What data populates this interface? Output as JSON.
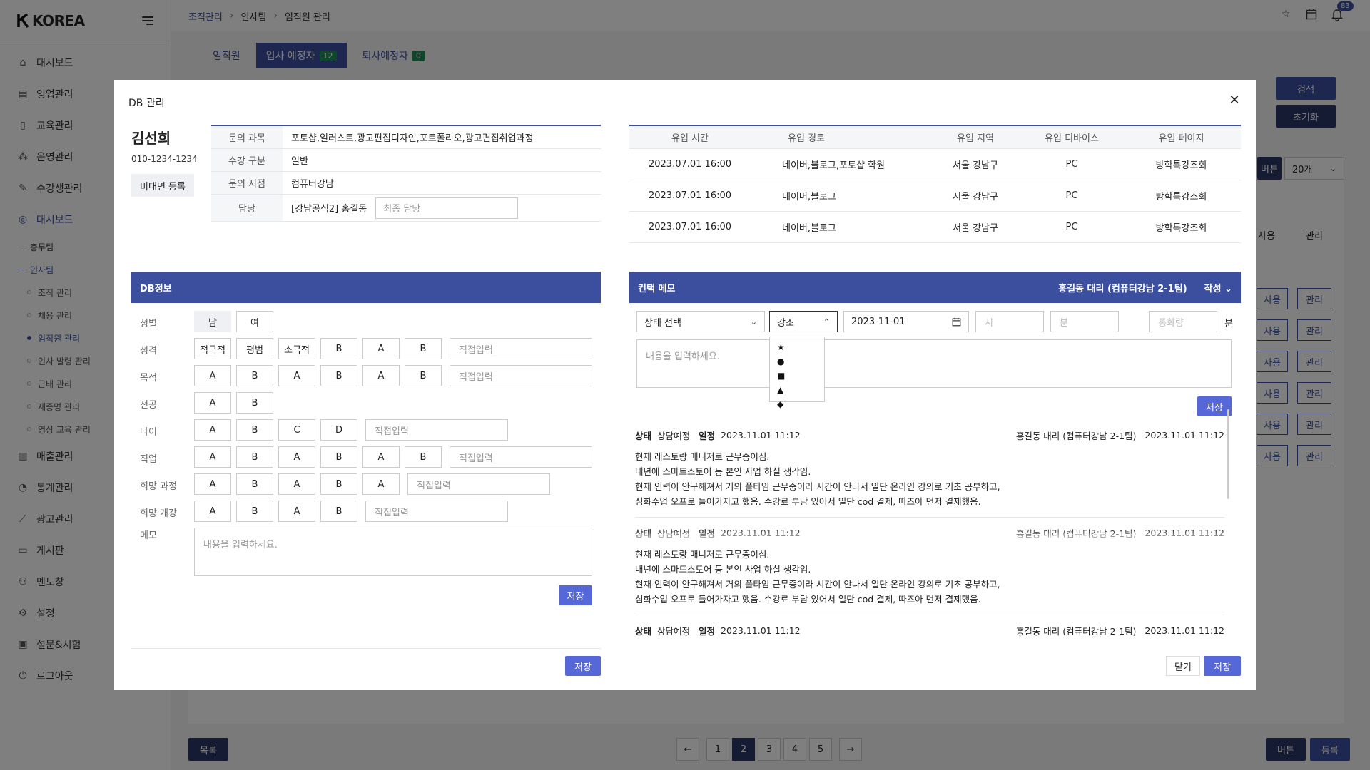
{
  "brand": "KOREA",
  "sidebar": {
    "items": [
      {
        "label": "대시보드",
        "icon": "home-icon"
      },
      {
        "label": "영업관리",
        "icon": "store-icon"
      },
      {
        "label": "교육관리",
        "icon": "book-icon"
      },
      {
        "label": "운영관리",
        "icon": "grid-icon"
      },
      {
        "label": "수강생관리",
        "icon": "edit-icon"
      },
      {
        "label": "대시보드",
        "icon": "globe-icon",
        "active": true
      }
    ],
    "sub1": [
      "총무팀",
      "인사팀"
    ],
    "sub2": [
      "조직 관리",
      "채용 관리",
      "임직원 관리",
      "인사 발령 관리",
      "근태 관리",
      "재증명 관리",
      "영상 교육 관리"
    ],
    "items_bottom": [
      {
        "label": "매출관리",
        "icon": "bar-chart-icon"
      },
      {
        "label": "통계관리",
        "icon": "pie-chart-icon"
      },
      {
        "label": "광고관리",
        "icon": "line-chart-icon"
      },
      {
        "label": "게시판",
        "icon": "document-icon"
      },
      {
        "label": "멘토창",
        "icon": "users-icon"
      },
      {
        "label": "설정",
        "icon": "gear-icon"
      },
      {
        "label": "설문&시험",
        "icon": "survey-icon"
      },
      {
        "label": "로그아웃",
        "icon": "power-icon"
      }
    ]
  },
  "breadcrumb": [
    "조직관리",
    "인사팀",
    "임직원 관리"
  ],
  "notifications_count": "83",
  "bg": {
    "tabs": [
      {
        "label": "임직원"
      },
      {
        "label": "입사 예정자",
        "count": "12"
      },
      {
        "label": "퇴사예정자",
        "count": "0"
      }
    ],
    "search_btn": "검색",
    "reset_btn": "초기화",
    "button_label": "버튼",
    "page_size": "20개",
    "col_use": "사용",
    "col_manage": "관리",
    "row_use": "사용",
    "row_manage": "관리",
    "list_btn": "목록",
    "register_btn": "등록",
    "pages": [
      "1",
      "2",
      "3",
      "4",
      "5"
    ],
    "current_page": "2"
  },
  "modal": {
    "title": "DB 관리",
    "person": {
      "name": "김선희",
      "phone": "010-1234-1234",
      "type_btn": "비대면 등록"
    },
    "info": [
      {
        "key": "문의 과목",
        "value": "포토샵,일러스트,광고편집디자인,포트폴리오,광고편집취업과정"
      },
      {
        "key": "수강 구분",
        "value": "일반"
      },
      {
        "key": "문의 지점",
        "value": "컴퓨터강남"
      },
      {
        "key": "담당",
        "value": "[강남공식2] 홍길동",
        "placeholder": "최종 담당"
      }
    ],
    "flow": {
      "headers": [
        "유입 시간",
        "유입 경로",
        "유입 지역",
        "유입 디바이스",
        "유입 페이지"
      ],
      "rows": [
        [
          "2023.07.01 16:00",
          "네이버,블로그,포토샵 학원",
          "서울 강남구",
          "PC",
          "방학특강조회"
        ],
        [
          "2023.07.01 16:00",
          "네이버,블로그",
          "서울 강남구",
          "PC",
          "방학특강조회"
        ],
        [
          "2023.07.01 16:00",
          "네이버,블로그",
          "서울 강남구",
          "PC",
          "방학특강조회"
        ]
      ]
    },
    "db": {
      "title": "DB정보",
      "direct_input": "직접입력",
      "memo_label": "메모",
      "memo_placeholder": "내용을 입력하세요.",
      "save": "저장",
      "rows": [
        {
          "label": "성별",
          "options": [
            "남",
            "여"
          ]
        },
        {
          "label": "성격",
          "options": [
            "적극적",
            "평범",
            "소극적",
            "B",
            "A",
            "B"
          ]
        },
        {
          "label": "목적",
          "options": [
            "A",
            "B",
            "A",
            "B",
            "A",
            "B"
          ]
        },
        {
          "label": "전공",
          "options": [
            "A",
            "B"
          ]
        },
        {
          "label": "나이",
          "options": [
            "A",
            "B",
            "C",
            "D"
          ]
        },
        {
          "label": "직업",
          "options": [
            "A",
            "B",
            "A",
            "B",
            "A",
            "B"
          ]
        },
        {
          "label": "희망 과정",
          "options": [
            "A",
            "B",
            "A",
            "B",
            "A"
          ]
        },
        {
          "label": "희망 개강",
          "options": [
            "A",
            "B",
            "A",
            "B"
          ]
        }
      ]
    },
    "memo": {
      "title": "컨택 메모",
      "author": "홍길동 대리 (컴퓨터강남 2-1팀)",
      "write": "작성",
      "status_select": "상태 선택",
      "emphasis_select": "강조",
      "emphasis_options": [
        "★",
        "●",
        "■",
        "▲",
        "◆"
      ],
      "date": "2023-11-01",
      "hour_placeholder": "시",
      "min_placeholder": "분",
      "call_placeholder": "통화량",
      "min_unit": "분",
      "content_placeholder": "내용을 입력하세요.",
      "save": "저장",
      "logs": [
        {
          "status_label": "상태",
          "status": "상담예정",
          "schedule_label": "일정",
          "schedule": "2023.11.01 11:12",
          "author": "홍길동 대리 (컴퓨터강남 2-1팀)",
          "time": "2023.11.01 11:12",
          "lines": [
            "현재 레스토랑 매니저로 근무중이심.",
            "내년에 스마트스토어 등 본인 사업 하실 생각임.",
            "현재 인력이 안구해져서 거의 풀타임 근무중이라 시간이 안나서 일단 온라인 강의로 기초 공부하고,",
            "심화수업 오프로 들어가자고 했음. 수강료 부담 있어서 일단 cod 결제, 따즈아 먼저 결제했음."
          ]
        },
        {
          "status_label": "상태",
          "status": "상담예정",
          "schedule_label": "일정",
          "schedule": "2023.11.01 11:12",
          "author": "홍길동 대리 (컴퓨터강남 2-1팀)",
          "time": "2023.11.01 11:12",
          "lines": [
            "현재 레스토랑 매니저로 근무중이심.",
            "내년에 스마트스토어 등 본인 사업 하실 생각임.",
            "현재 인력이 안구해져서 거의 풀타임 근무중이라 시간이 안나서 일단 온라인 강의로 기초 공부하고,",
            "심화수업 오프로 들어가자고 했음. 수강료 부담 있어서 일단 cod 결제, 따즈아 먼저 결제했음."
          ]
        },
        {
          "status_label": "상태",
          "status": "상담예정",
          "schedule_label": "일정",
          "schedule": "2023.11.01 11:12",
          "author": "홍길동 대리 (컴퓨터강남 2-1팀)",
          "time": "2023.11.01 11:12",
          "lines": []
        }
      ]
    },
    "footer": {
      "save": "저장",
      "close": "닫기",
      "save2": "저장"
    }
  },
  "colors": {
    "primary": "#3b4f9e",
    "button": "#5667d8",
    "dark": "#2c3769",
    "badge_green": "#1f8f5a"
  }
}
